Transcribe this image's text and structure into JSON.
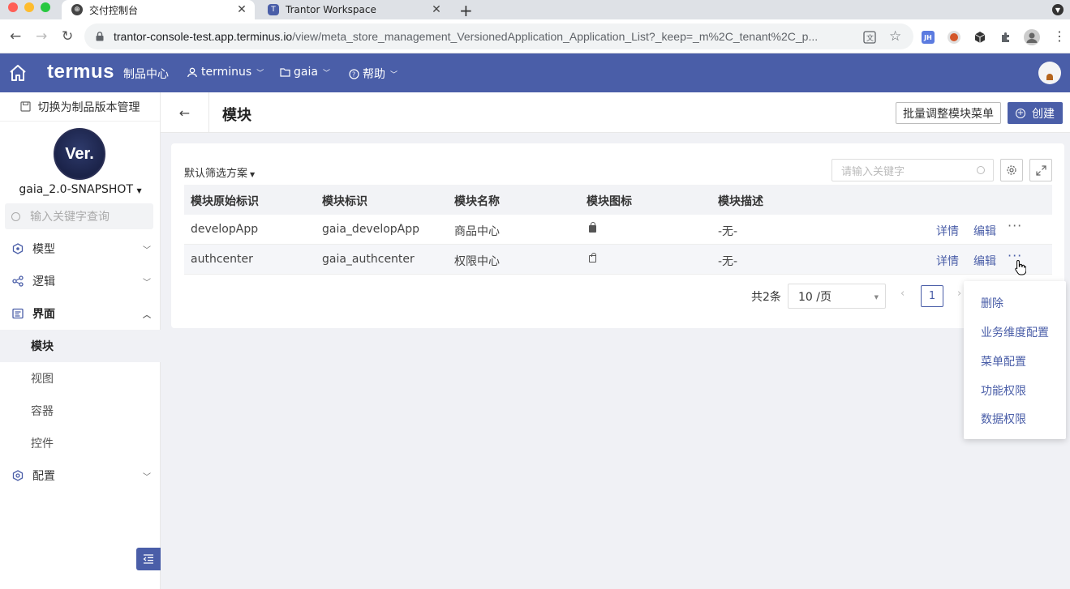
{
  "browser": {
    "tabs": [
      {
        "title": "交付控制台",
        "active": true
      },
      {
        "title": "Trantor Workspace",
        "active": false
      }
    ],
    "url_main": "trantor-console-test.app.terminus.io",
    "url_rest": "/view/meta_store_management_VersionedApplication_Application_List?_keep=_m%2C_tenant%2C_p...",
    "extension_label": "JH"
  },
  "appbar": {
    "brand": "termus",
    "product_center": "制品中心",
    "org": "terminus",
    "project": "gaia",
    "help": "帮助"
  },
  "sidebar": {
    "switch_label": "切换为制品版本管理",
    "logo_text": "Ver.",
    "version_name": "gaia_2.0-SNAPSHOT",
    "search_placeholder": "输入关键字查询",
    "items": [
      {
        "label": "模型"
      },
      {
        "label": "逻辑"
      },
      {
        "label": "界面"
      },
      {
        "label": "配置"
      }
    ],
    "subitems": [
      {
        "label": "模块",
        "active": true
      },
      {
        "label": "视图"
      },
      {
        "label": "容器"
      },
      {
        "label": "控件"
      }
    ]
  },
  "page": {
    "title": "模块",
    "batch_button": "批量调整模块菜单",
    "create_button": "创建"
  },
  "table": {
    "filter_label": "默认筛选方案",
    "search_placeholder": "请输入关键字",
    "columns": [
      "模块原始标识",
      "模块标识",
      "模块名称",
      "模块图标",
      "模块描述"
    ],
    "rows": [
      {
        "raw_id": "developApp",
        "id": "gaia_developApp",
        "name": "商品中心",
        "icon": "lock-solid",
        "desc": "-无-"
      },
      {
        "raw_id": "authcenter",
        "id": "gaia_authcenter",
        "name": "权限中心",
        "icon": "lock-outline",
        "desc": "-无-"
      }
    ],
    "row_actions": {
      "detail": "详情",
      "edit": "编辑",
      "more": "···"
    }
  },
  "pagination": {
    "total": "共2条",
    "page_size": "10 /页",
    "current_page": "1"
  },
  "dropdown": {
    "items": [
      "删除",
      "业务维度配置",
      "菜单配置",
      "功能权限",
      "数据权限"
    ]
  },
  "colors": {
    "primary": "#4a5ea8",
    "page_bg": "#f0f1f5"
  }
}
